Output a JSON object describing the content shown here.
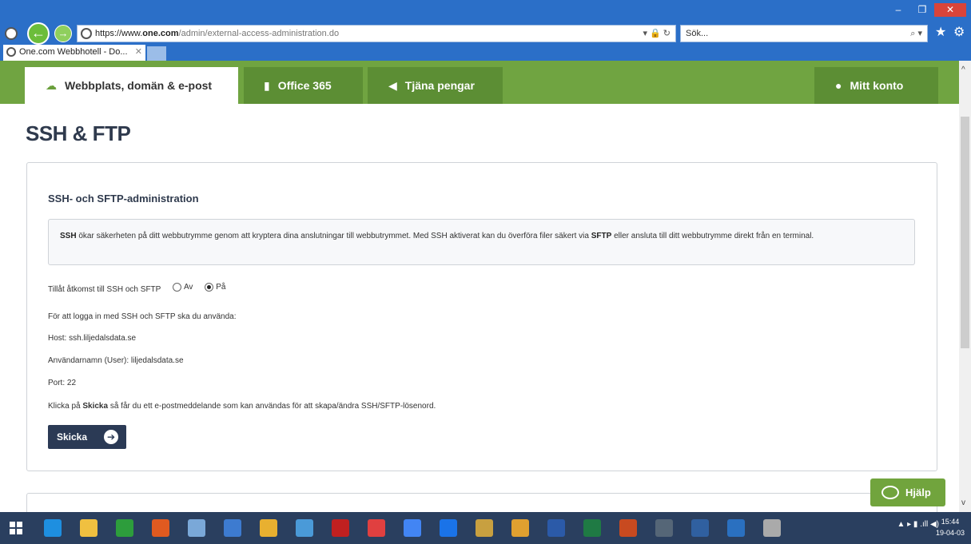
{
  "browser": {
    "url_scheme": "https://www.",
    "url_host": "one.com",
    "url_path": "/admin/external-access-administration.do",
    "search_placeholder": "Sök...",
    "tab_title": "One.com Webbhotell - Do...",
    "window_controls": [
      "–",
      "❐",
      "✕"
    ]
  },
  "sitenav": {
    "tabs": [
      {
        "label": "Webbplats, domän & e-post",
        "icon": "cloud-icon"
      },
      {
        "label": "Office 365",
        "icon": "office-icon"
      },
      {
        "label": "Tjäna pengar",
        "icon": "megaphone-icon"
      },
      {
        "label": "Mitt konto",
        "icon": "user-icon"
      }
    ]
  },
  "page": {
    "title": "SSH & FTP",
    "section_title": "SSH- och SFTP-administration",
    "info": {
      "bold1": "SSH",
      "text1": " ökar säkerheten på ditt webbutrymme genom att kryptera dina anslutningar till webbutrymmet. Med SSH aktiverat kan du överföra filer säkert via ",
      "bold2": "SFTP",
      "text2": " eller ansluta till ditt webbutrymme direkt från en terminal."
    },
    "access_label": "Tillåt åtkomst till SSH och SFTP",
    "radio_off": "Av",
    "radio_on": "På",
    "radio_selected": "På",
    "login_intro": "För att logga in med SSH och SFTP ska du använda:",
    "host": "Host: ssh.liljedalsdata.se",
    "username": "Användarnamn (User): liljedalsdata.se",
    "port": "Port: 22",
    "send_prefix": "Klicka på ",
    "send_bold": "Skicka",
    "send_suffix": " så får du ett e-postmeddelande som kan användas för att skapa/ändra SSH/SFTP-lösenord.",
    "send_button": "Skicka",
    "help_button": "Hjälp"
  },
  "taskbar": {
    "time": "15:44",
    "date": "19-04-03",
    "accent": "#2a3f5f",
    "icons": [
      "edge-icon",
      "explorer-icon",
      "store-icon",
      "paint-icon",
      "notepad-icon",
      "calc-icon",
      "font-icon",
      "pen-icon",
      "filezilla-icon",
      "media-icon",
      "google-icon",
      "teamviewer-icon",
      "sql-icon",
      "chrome-icon",
      "word-icon",
      "excel-icon",
      "powerpoint-icon",
      "tool-icon",
      "save-icon",
      "outlook-icon",
      "ie-icon"
    ]
  },
  "colors": {
    "nav_green": "#70a441",
    "nav_tab_dark": "#5c8e34",
    "button_navy": "#2b3a55",
    "chrome_blue": "#2b6fc8"
  }
}
